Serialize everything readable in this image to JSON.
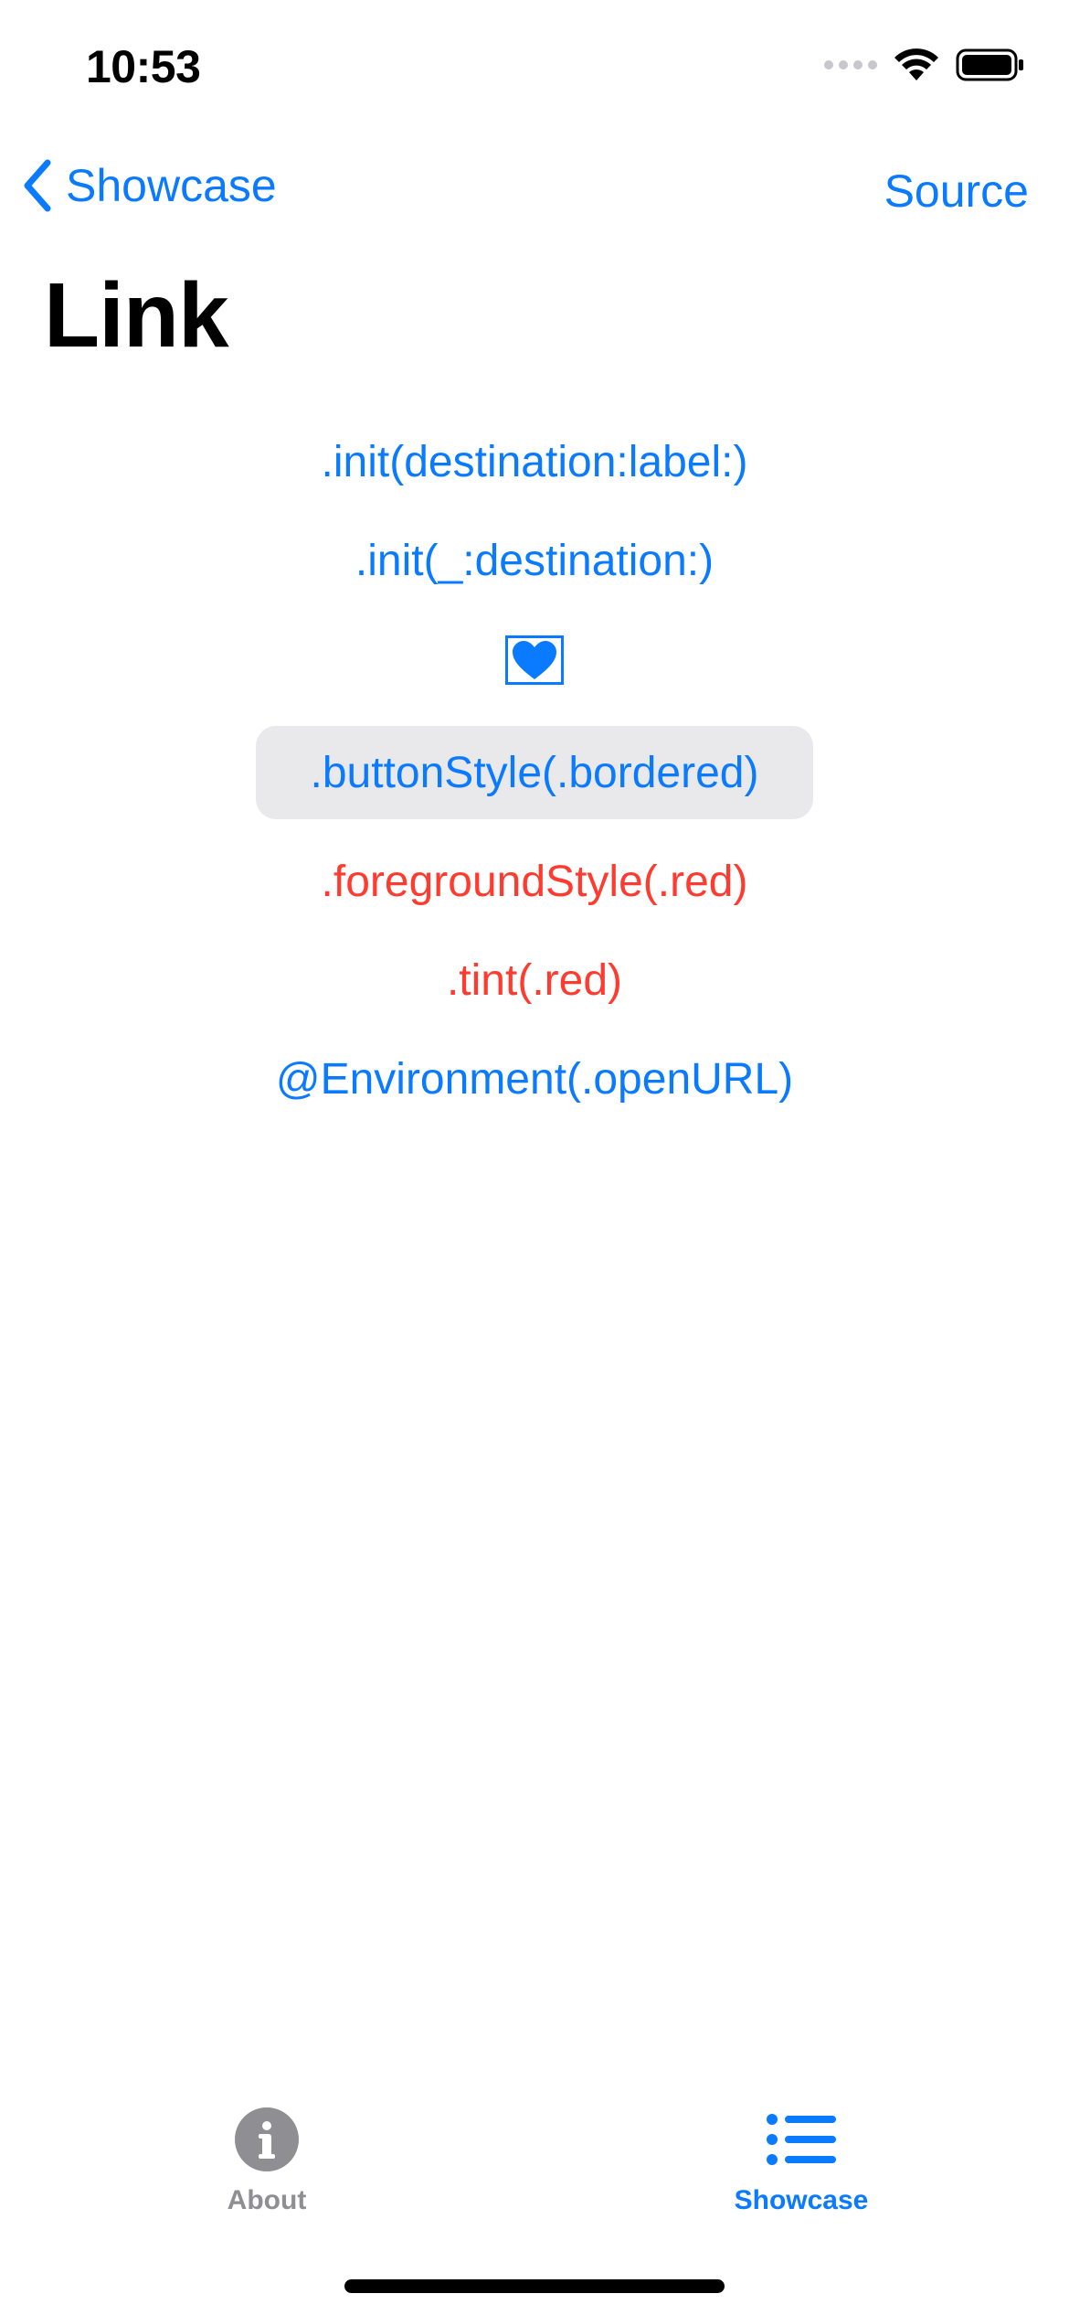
{
  "status_bar": {
    "time": "10:53"
  },
  "nav": {
    "back_label": "Showcase",
    "action_label": "Source"
  },
  "page": {
    "title": "Link"
  },
  "links": {
    "init_destination_label": ".init(destination:label:)",
    "init_underscore_destination": ".init(_:destination:)",
    "heart_icon": "heart-fill",
    "bordered": ".buttonStyle(.bordered)",
    "foreground_red": ".foregroundStyle(.red)",
    "tint_red": ".tint(.red)",
    "environment_open_url": "@Environment(.openURL)"
  },
  "tab_bar": {
    "items": [
      {
        "label": "About",
        "icon": "info-circle",
        "selected": false
      },
      {
        "label": "Showcase",
        "icon": "list-bullet",
        "selected": true
      }
    ]
  },
  "colors": {
    "accent": "#0a7aff",
    "red": "#ff3b30",
    "inactive_tab": "#8e8e93",
    "bordered_bg": "#e9e9eb"
  }
}
